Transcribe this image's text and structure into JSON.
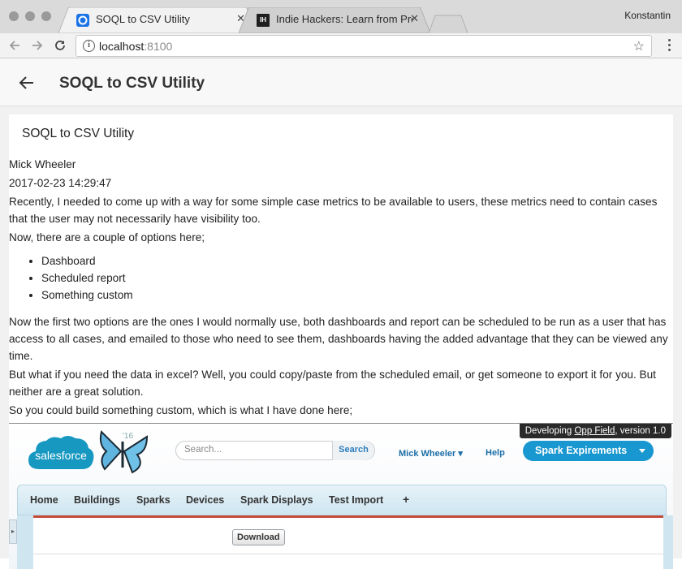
{
  "browser": {
    "tabs": [
      {
        "title": "SOQL to CSV Utility",
        "favicon": "chrome-app-icon",
        "active": true
      },
      {
        "title": "Indie Hackers: Learn from Prof",
        "favicon": "indie-hackers-logo-icon",
        "favicon_text": "IH",
        "active": false
      }
    ],
    "tab_close_glyph": "✕",
    "profile_name": "Konstantin",
    "url_host": "localhost",
    "url_port": ":8100",
    "info_glyph": "i",
    "star_glyph": "☆"
  },
  "app": {
    "header_title": "SOQL to CSV Utility"
  },
  "article": {
    "card_title": "SOQL to CSV Utility",
    "author": "Mick Wheeler",
    "date": "2017-02-23 14:29:47",
    "paragraphs_top": [
      "Recently, I needed to come up with a way for some simple case metrics to be available to users, these metrics need to contain cases that the user may not necessarily have visibility too.",
      "Now, there are a couple of options here;"
    ],
    "options": [
      "Dashboard",
      "Scheduled report",
      "Something custom"
    ],
    "paragraphs_bottom": [
      "Now the first two options are the ones I would normally use, both dashboards and report can be scheduled to be run as a user that has access to all cases, and emailed to those who need to see them, dashboards having the added advantage that they can be viewed any time.",
      "But what if you need the data in excel? Well, you could copy/paste from the scheduled email, or get someone to export it for you. But neither are a great solution.",
      "So you could build something custom, which is what I have done here;"
    ]
  },
  "screenshot": {
    "tooltip_prefix": "Developing ",
    "tooltip_link": "Opp Field",
    "tooltip_suffix": ", version 1.0",
    "logo_text": "salesforce",
    "logo_badge": "'16",
    "search_placeholder": "Search...",
    "search_button": "Search",
    "user_menu": "Mick Wheeler",
    "help": "Help",
    "app_menu": "Spark Expirements",
    "tabs": [
      "Home",
      "Buildings",
      "Sparks",
      "Devices",
      "Spark Displays",
      "Test Import",
      "+"
    ],
    "download_button": "Download",
    "colors": {
      "brand_blue": "#1897d0",
      "accent_red": "#c64d3a",
      "link_blue": "#1d6fa8"
    }
  }
}
